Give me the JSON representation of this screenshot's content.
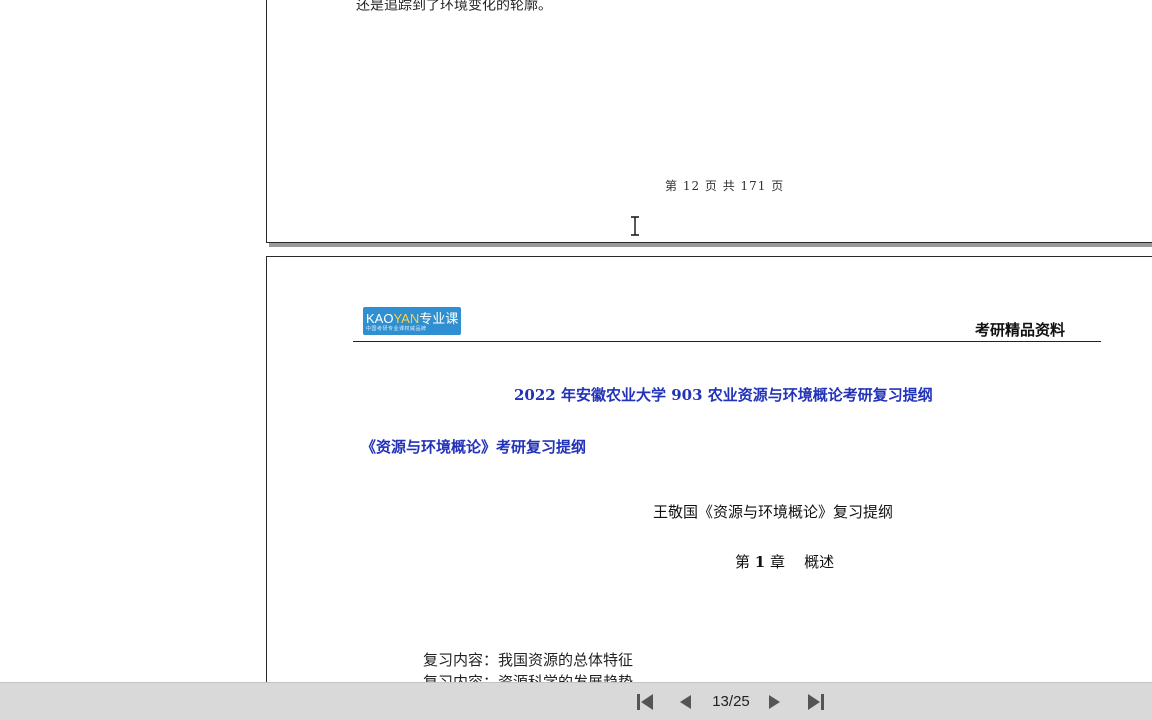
{
  "viewer": {
    "previous_page": {
      "last_line": "还是追踪到了环境变化的轮廓。",
      "footer": "第 12 页 共 171 页"
    },
    "current_page": {
      "logo": {
        "brand_a": "KAO",
        "brand_b": "YAN",
        "brand_c": "专业课",
        "tagline": "中国考研专业课权威品牌"
      },
      "header_right": "考研精品资料",
      "title": "2022 年安徽农业大学 903 农业资源与环境概论考研复习提纲",
      "subtitle": "《资源与环境概论》考研复习提纲",
      "outline_title": "王敬国《资源与环境概论》复习提纲",
      "chapter_prefix": "第",
      "chapter_number": "1",
      "chapter_suffix": "章",
      "chapter_name": "概述",
      "review_lines": [
        "复习内容：我国资源的总体特征",
        "复习内容：资源科学的发展趋势"
      ]
    }
  },
  "navigation": {
    "page_indicator": "13/25",
    "current_page": 13,
    "total_pages": 25,
    "buttons": [
      "first-page-icon",
      "previous-page-icon",
      "next-page-icon",
      "last-page-icon"
    ]
  },
  "colors": {
    "title_blue": "#2233b8",
    "logo_blue": "#2f8fd0",
    "logo_yellow": "#ffd23c",
    "navbar_bg": "#d9d9d9",
    "nav_icon": "#555555"
  }
}
